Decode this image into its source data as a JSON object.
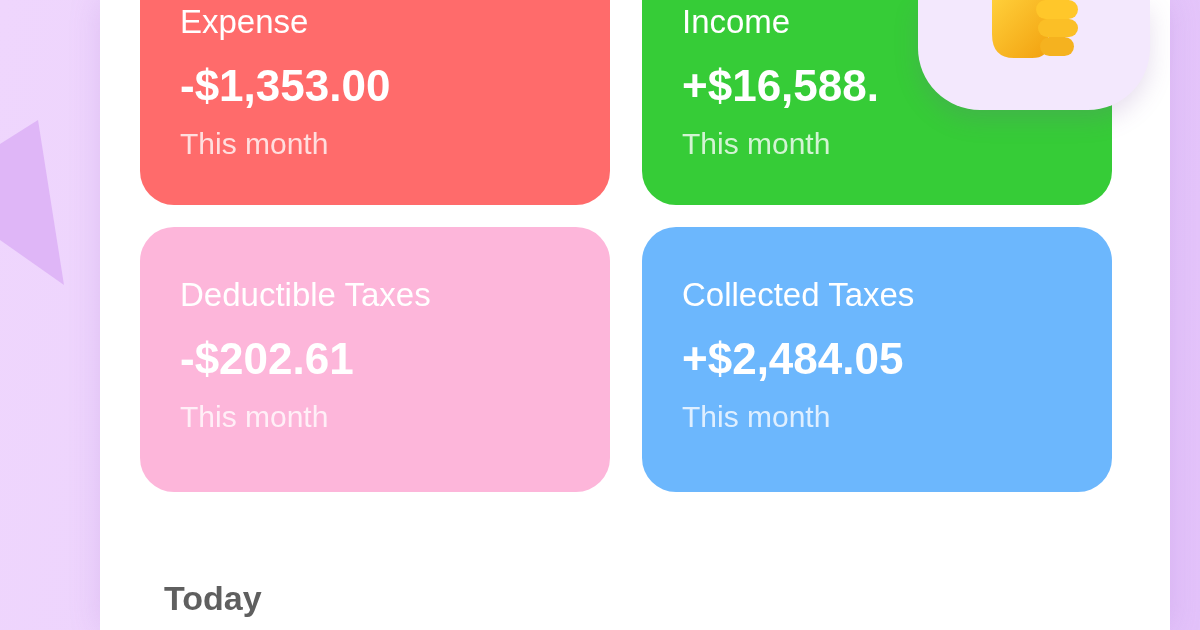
{
  "cards": [
    {
      "label": "Expense",
      "amount": "-$1,353.00",
      "period": "This month",
      "color": "#ff6b6b"
    },
    {
      "label": "Income",
      "amount": "+$16,588.",
      "period": "This month",
      "color": "#36cc37"
    },
    {
      "label": "Deductible Taxes",
      "amount": "-$202.61",
      "period": "This month",
      "color": "#fdb6da"
    },
    {
      "label": "Collected Taxes",
      "amount": "+$2,484.05",
      "period": "This month",
      "color": "#6cb7fd"
    }
  ],
  "section_title": "Today"
}
